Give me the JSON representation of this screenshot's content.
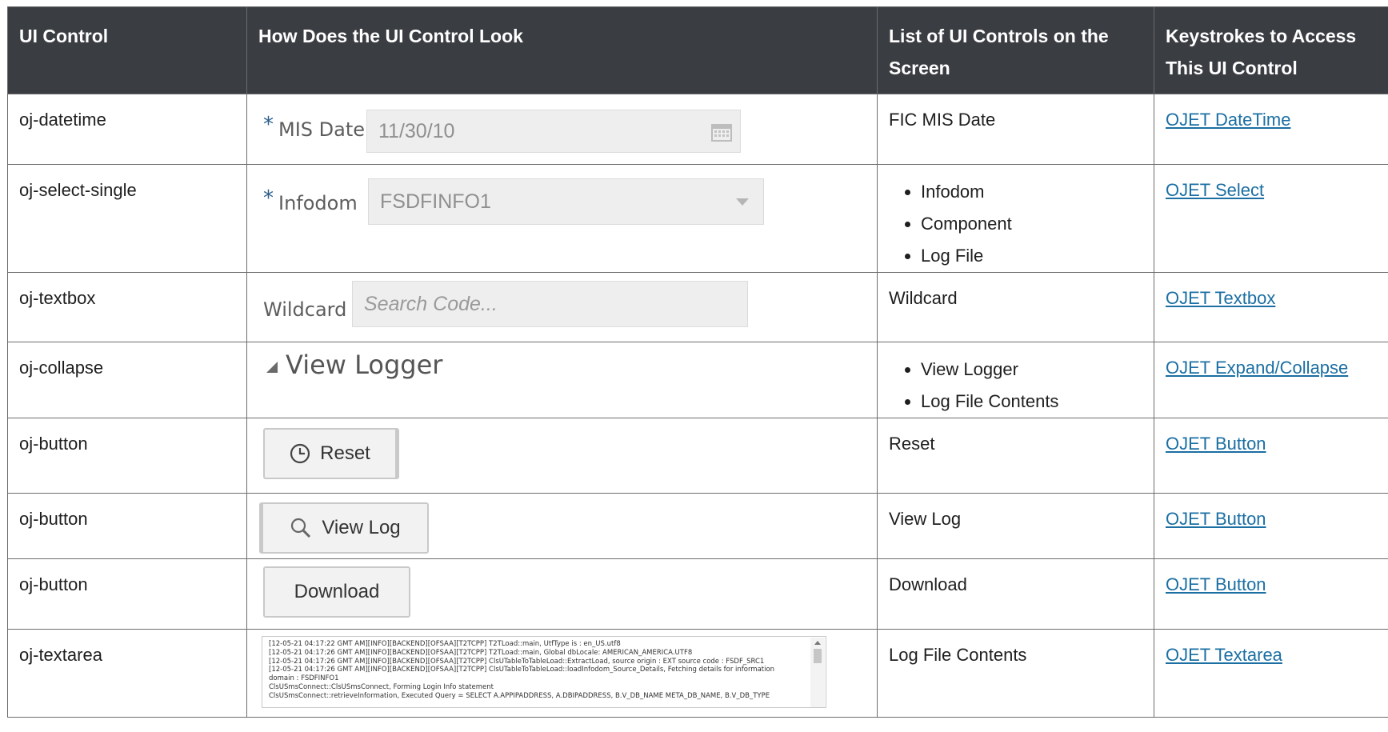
{
  "table": {
    "headers": {
      "control": "UI Control",
      "look": "How Does the UI Control Look",
      "list": "List of UI Controls on the Screen",
      "keys": "Keystrokes to Access This UI Control"
    },
    "rows": [
      {
        "control": "oj-datetime",
        "list": [
          "FIC MIS Date"
        ],
        "link": "OJET DateTime",
        "widget": {
          "required": "*",
          "label": "MIS Date",
          "value": "11/30/10",
          "icon": "calendar-icon"
        }
      },
      {
        "control": "oj-select-single",
        "list": [
          "Infodom",
          "Component",
          "Log File"
        ],
        "link": "OJET Select",
        "widget": {
          "required": "*",
          "label": "Infodom",
          "value": "FSDFINFO1",
          "icon": "chevron-down-icon"
        }
      },
      {
        "control": "oj-textbox",
        "list": [
          "Wildcard"
        ],
        "link": "OJET Textbox",
        "widget": {
          "label": "Wildcard",
          "placeholder": "Search Code..."
        }
      },
      {
        "control": "oj-collapse",
        "list": [
          "View Logger",
          "Log File Contents"
        ],
        "link": "OJET Expand/Collapse",
        "widget": {
          "label": "View Logger",
          "icon": "collapse-triangle-icon"
        }
      },
      {
        "control": "oj-button",
        "list": [
          "Reset"
        ],
        "link": "OJET Button",
        "widget": {
          "label": "Reset",
          "icon": "clock-icon"
        }
      },
      {
        "control": "oj-button",
        "list": [
          "View Log"
        ],
        "link": "OJET Button",
        "widget": {
          "label": "View Log",
          "icon": "search-icon"
        }
      },
      {
        "control": "oj-button",
        "list": [
          "Download"
        ],
        "link": "OJET Button",
        "widget": {
          "label": "Download"
        }
      },
      {
        "control": "oj-textarea",
        "list": [
          "Log File Contents"
        ],
        "link": "OJET Textarea",
        "widget": {
          "lines": [
            "[12-05-21 04:17:22 GMT AM][INFO][BACKEND][OFSAA][T2TCPP] T2TLoad::main, UtfType is : en_US.utf8",
            "[12-05-21 04:17:26 GMT AM][INFO][BACKEND][OFSAA][T2TCPP] T2TLoad::main, Global dbLocale: AMERICAN_AMERICA.UTF8",
            "[12-05-21 04:17:26 GMT AM][INFO][BACKEND][OFSAA][T2TCPP] ClsUTableToTableLoad::ExtractLoad, source origin : EXT source code : FSDF_SRC1",
            "[12-05-21 04:17:26 GMT AM][INFO][BACKEND][OFSAA][T2TCPP] ClsUTableToTableLoad::loadInfodom_Source_Details, Fetching details for information",
            "domain : FSDFINFO1",
            "ClsUSmsConnect::ClsUSmsConnect, Forming Login Info statement",
            "ClsUSmsConnect::retrieveInformation, Executed Query = SELECT A.APPIPADDRESS, A.DBIPADDRESS, B.V_DB_NAME META_DB_NAME, B.V_DB_TYPE"
          ]
        }
      }
    ]
  }
}
